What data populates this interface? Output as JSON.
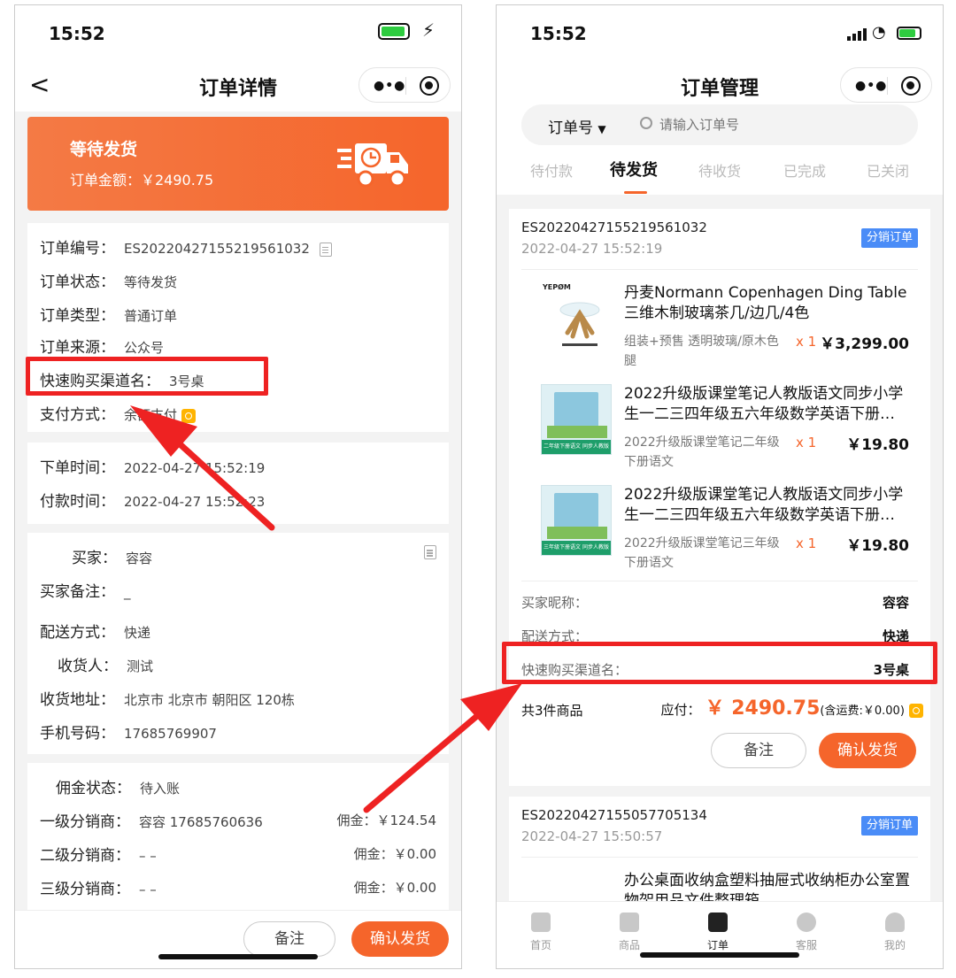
{
  "left": {
    "status_bar": {
      "time": "15:52"
    },
    "nav": {
      "title": "订单详情"
    },
    "banner": {
      "status": "等待发货",
      "amount": "订单金额：￥2490.75",
      "icon": "truck-icon",
      "color": "#f5652b"
    },
    "order_info": [
      {
        "label": "订单编号：",
        "value": "ES20220427155219561032"
      },
      {
        "label": "订单状态：",
        "value": "等待发货"
      },
      {
        "label": "订单类型：",
        "value": "普通订单"
      },
      {
        "label": "订单来源：",
        "value": "公众号"
      },
      {
        "label": "快速购买渠道名：",
        "value": "3号桌"
      },
      {
        "label": "支付方式：",
        "value": "余额支付"
      }
    ],
    "times": [
      {
        "label": "下单时间：",
        "value": "2022-04-27 15:52:19"
      },
      {
        "label": "付款时间：",
        "value": "2022-04-27 15:52:23"
      }
    ],
    "buyer": [
      {
        "label": "买家：",
        "value": "容容"
      },
      {
        "label": "买家备注：",
        "value": "_"
      },
      {
        "label": "配送方式：",
        "value": "快递"
      },
      {
        "label": "收货人：",
        "value": "测试"
      },
      {
        "label": "收货地址：",
        "value": "北京市 北京市 朝阳区 120栋"
      },
      {
        "label": "手机号码：",
        "value": "17685769907"
      }
    ],
    "commission": [
      {
        "label": "佣金状态：",
        "value": "待入账",
        "commission": ""
      },
      {
        "label": "一级分销商：",
        "value": "容容 17685760636",
        "commission": "佣金：￥124.54"
      },
      {
        "label": "二级分销商：",
        "value": "– –",
        "commission": "佣金：￥0.00"
      },
      {
        "label": "三级分销商：",
        "value": "– –",
        "commission": "佣金：￥0.00"
      }
    ],
    "actions": {
      "note": "备注",
      "confirm": "确认发货"
    }
  },
  "right": {
    "status_bar": {
      "time": "15:52"
    },
    "nav": {
      "title": "订单管理"
    },
    "search": {
      "filter": "订单号",
      "placeholder": "请输入订单号"
    },
    "tabs": [
      "待付款",
      "待发货",
      "待收货",
      "已完成",
      "已关闭"
    ],
    "active_tab": "待发货",
    "order1": {
      "order_no": "ES20220427155219561032",
      "time": "2022-04-27 15:52:19",
      "tag": "分销订单",
      "products": [
        {
          "name": "丹麦Normann Copenhagen Ding Table三维木制玻璃茶几/边几/4色",
          "spec": "组装+预售 透明玻璃/原木色腿",
          "qty": "x 1",
          "price": "￥3,299.00",
          "brand": "YEPØM"
        },
        {
          "name": "2022升级版课堂笔记人教版语文同步小学生一二三四年级五六年级数学英语下册…",
          "spec": "2022升级版课堂笔记二年级下册语文",
          "qty": "x 1",
          "price": "￥19.80",
          "book_tag": "二年级下册语文 同步人教版"
        },
        {
          "name": "2022升级版课堂笔记人教版语文同步小学生一二三四年级五六年级数学英语下册…",
          "spec": "2022升级版课堂笔记三年级下册语文",
          "qty": "x 1",
          "price": "￥19.80",
          "book_tag": "三年级下册语文 同步人教版"
        }
      ],
      "buyer_nick": {
        "label": "买家昵称：",
        "value": "容容"
      },
      "delivery": {
        "label": "配送方式：",
        "value": "快递"
      },
      "channel": {
        "label": "快速购买渠道名：",
        "value": "3号桌"
      },
      "count": "共3件商品",
      "payable_label": "应付：",
      "payable": "￥ 2490.75",
      "shipping": "(含运费:￥0.00)",
      "note_btn": "备注",
      "confirm_btn": "确认发货"
    },
    "order2": {
      "order_no": "ES20220427155057705134",
      "time": "2022-04-27 15:50:57",
      "tag": "分销订单",
      "product_name": "办公桌面收纳盒塑料抽屉式收纳柜办公室置物架用品文件整理箱"
    },
    "tabbar": [
      {
        "label": "首页",
        "icon": "store-icon"
      },
      {
        "label": "商品",
        "icon": "bag-icon"
      },
      {
        "label": "订单",
        "icon": "order-icon"
      },
      {
        "label": "客服",
        "icon": "service-icon"
      },
      {
        "label": "我的",
        "icon": "user-icon"
      }
    ]
  },
  "annotation_color": "#ee2222"
}
